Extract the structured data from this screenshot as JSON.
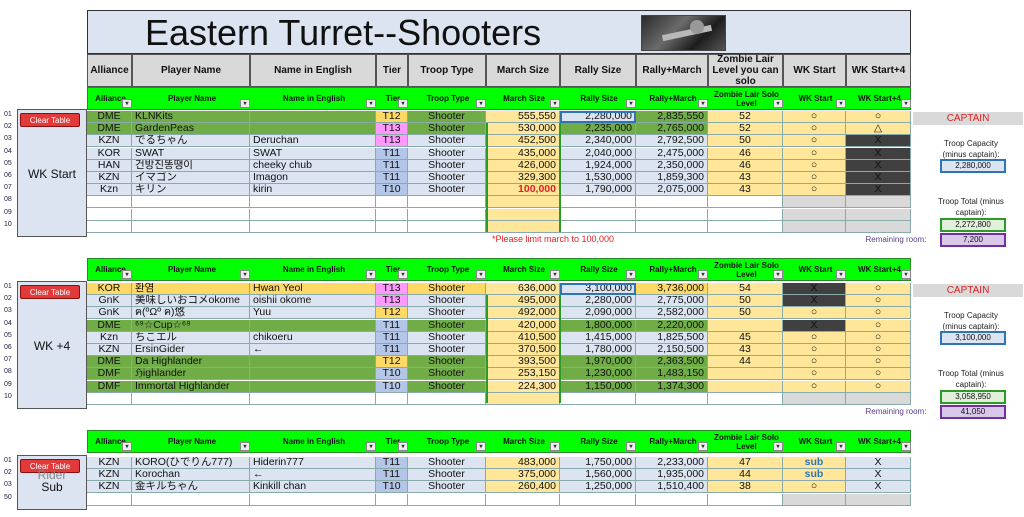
{
  "title": "Eastern Turret--Shooters",
  "top_headers": [
    "Alliance",
    "Player Name",
    "Name in English",
    "Tier",
    "Troop Type",
    "March Size",
    "Rally Size",
    "Rally+March",
    "Zombie Lair Level you can solo",
    "WK Start",
    "WK Start+4"
  ],
  "green_headers": [
    "Alliance",
    "Player Name",
    "Name in English",
    "Tier",
    "Troop Type",
    "March Size",
    "Rally Size",
    "Rally+March",
    "Zombie Lair Solo Level",
    "WK Start",
    "WK Start+4"
  ],
  "clear_label": "Clear Table",
  "sections": [
    {
      "label": "WK Start",
      "rows": [
        [
          "DME",
          "KLNKits",
          "",
          "T12",
          "Shooter",
          "555,550",
          "2,280,000",
          "2,835,550",
          "52",
          "○",
          "○"
        ],
        [
          "DME",
          "GardenPeas",
          "",
          "T13",
          "Shooter",
          "530,000",
          "2,235,000",
          "2,765,000",
          "52",
          "○",
          "△"
        ],
        [
          "KZN",
          "でるちゃん",
          "Deruchan",
          "T13",
          "Shooter",
          "452,500",
          "2,340,000",
          "2,792,500",
          "50",
          "○",
          "X"
        ],
        [
          "KOR",
          "SWAT",
          "SWAT",
          "T11",
          "Shooter",
          "435,000",
          "2,040,000",
          "2,475,000",
          "46",
          "○",
          "X"
        ],
        [
          "HAN",
          "건방진똥땡이",
          "cheeky chub",
          "T11",
          "Shooter",
          "426,000",
          "1,924,000",
          "2,350,000",
          "46",
          "○",
          "X"
        ],
        [
          "KZN",
          "イマゴン",
          "Imagon",
          "T11",
          "Shooter",
          "329,300",
          "1,530,000",
          "1,859,300",
          "43",
          "○",
          "X"
        ],
        [
          "Kzn",
          "キリン",
          "kirin",
          "T10",
          "Shooter",
          "100,000",
          "1,790,000",
          "2,075,000",
          "43",
          "○",
          "X"
        ],
        [
          "",
          "",
          "",
          "",
          "",
          "",
          "",
          "",
          "",
          "",
          ""
        ],
        [
          "",
          "",
          "",
          "",
          "",
          "",
          "",
          "",
          "",
          "",
          ""
        ],
        [
          "",
          "",
          "",
          "",
          "",
          "",
          "",
          "",
          "",
          "",
          ""
        ]
      ]
    },
    {
      "label": "WK +4",
      "rows": [
        [
          "KOR",
          "환염",
          "Hwan Yeol",
          "T13",
          "Shooter",
          "636,000",
          "3,100,000",
          "3,736,000",
          "54",
          "X",
          "○"
        ],
        [
          "GnK",
          "美味しいおコメokome",
          "oishii okome",
          "T13",
          "Shooter",
          "495,000",
          "2,280,000",
          "2,775,000",
          "50",
          "X",
          "○"
        ],
        [
          "GnK",
          "ฅ(ºΩº ฅ)悠",
          "Yuu",
          "T12",
          "Shooter",
          "492,000",
          "2,090,000",
          "2,582,000",
          "50",
          "○",
          "○"
        ],
        [
          "DME",
          "⁶⁹☆Cup☆⁶⁹",
          "",
          "T11",
          "Shooter",
          "420,000",
          "1,800,000",
          "2,220,000",
          "",
          "X",
          "○"
        ],
        [
          "Kzn",
          "ちこエル",
          "chikoeru",
          "T11",
          "Shooter",
          "410,500",
          "1,415,000",
          "1,825,500",
          "45",
          "○",
          "○"
        ],
        [
          "KZN",
          "ErsinGider",
          "←",
          "T11",
          "Shooter",
          "370,500",
          "1,780,000",
          "2,150,500",
          "43",
          "○",
          "○"
        ],
        [
          "DME",
          "Da Highlander",
          "",
          "T12",
          "Shooter",
          "393,500",
          "1,970,000",
          "2,363,500",
          "44",
          "○",
          "○"
        ],
        [
          "DMF",
          "ℌighlander",
          "",
          "T10",
          "Shooter",
          "253,150",
          "1,230,000",
          "1,483,150",
          "",
          "○",
          "○"
        ],
        [
          "DMF",
          "Immortal Highlander",
          "",
          "T10",
          "Shooter",
          "224,300",
          "1,150,000",
          "1,374,300",
          "",
          "○",
          "○"
        ],
        [
          "",
          "",
          "",
          "",
          "",
          "",
          "",
          "",
          "",
          "",
          ""
        ]
      ]
    },
    {
      "label": "Sub",
      "label_hidden": "Rider",
      "rows": [
        [
          "KZN",
          "KORO(ひでりん777)",
          "Hiderin777",
          "T11",
          "Shooter",
          "483,000",
          "1,750,000",
          "2,233,000",
          "47",
          "sub",
          "X"
        ],
        [
          "KZN",
          "Korochan",
          "←",
          "T11",
          "Shooter",
          "375,000",
          "1,560,000",
          "1,935,000",
          "44",
          "sub",
          "X"
        ],
        [
          "KZN",
          "金キルちゃん",
          "Kinkill chan",
          "T10",
          "Shooter",
          "260,400",
          "1,250,000",
          "1,510,400",
          "38",
          "○",
          "X"
        ],
        [
          "",
          "",
          "",
          "",
          "",
          "",
          "",
          "",
          "",
          "",
          ""
        ]
      ]
    }
  ],
  "row_numbers": {
    "s1": [
      "01",
      "02",
      "03",
      "04",
      "05",
      "06",
      "07",
      "08",
      "09",
      "10"
    ],
    "s2": [
      "01",
      "02",
      "03",
      "04",
      "05",
      "06",
      "07",
      "08",
      "09",
      "10"
    ],
    "s3": [
      "01",
      "02",
      "03",
      "50"
    ]
  },
  "side1": {
    "captain": "CAPTAIN",
    "cap_label": "Troop Capacity (minus captain):",
    "cap_value": "2,280,000",
    "total_label": "Troop Total (minus captain):",
    "total_value": "2,272,800",
    "remaining_label": "Remaining room:",
    "remaining_value": "7,200",
    "note": "*Please limit march to 100,000"
  },
  "side2": {
    "captain": "CAPTAIN",
    "cap_label": "Troop Capacity (minus captain):",
    "cap_value": "3,100,000",
    "total_label": "Troop Total (minus captain):",
    "total_value": "3,058,950",
    "remaining_label": "Remaining room:",
    "remaining_value": "41,050"
  },
  "colors": {
    "green_header": "#00ff00",
    "tier_pink": "#ff99ff",
    "tier_blue": "#b4c6e7",
    "tier_yellow": "#ffd966",
    "march_yellow": "#ffe699",
    "row_green": "#70ad47",
    "row_blue": "#dce3f1",
    "dark": "#404040",
    "captain_red": "#e02020"
  }
}
